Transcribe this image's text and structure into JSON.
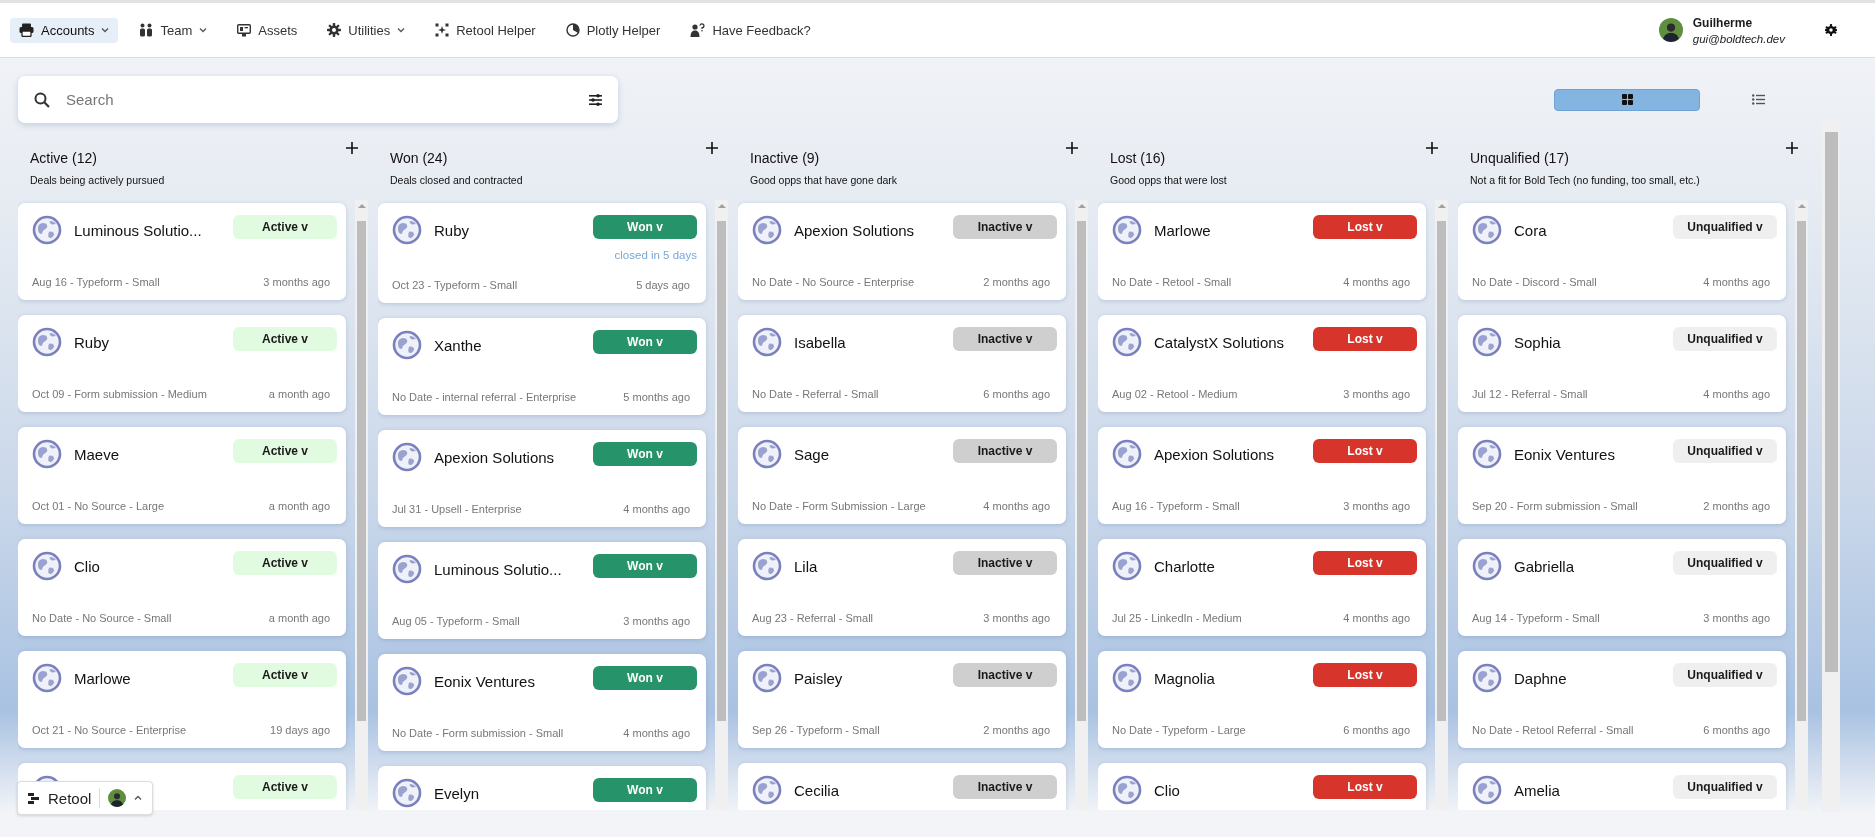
{
  "nav": [
    {
      "label": "Accounts",
      "dropdown": true,
      "selected": true
    },
    {
      "label": "Team",
      "dropdown": true,
      "selected": false
    },
    {
      "label": "Assets",
      "dropdown": false,
      "selected": false
    },
    {
      "label": "Utilities",
      "dropdown": true,
      "selected": false
    },
    {
      "label": "Retool Helper",
      "dropdown": false,
      "selected": false
    },
    {
      "label": "Plotly Helper",
      "dropdown": false,
      "selected": false
    },
    {
      "label": "Have Feedback?",
      "dropdown": false,
      "selected": false
    }
  ],
  "user": {
    "name": "Guilherme",
    "email": "gui@boldtech.dev"
  },
  "search": {
    "placeholder": "Search"
  },
  "view_toggle": [
    {
      "kind": "grid",
      "selected": true
    },
    {
      "kind": "list",
      "selected": false
    }
  ],
  "columns": [
    {
      "title": "Active (12)",
      "subtitle": "Deals being actively pursued",
      "cards": [
        {
          "name": "Luminous Solutio...",
          "status": "Active v",
          "kind": "active",
          "meta": "Aug 16 - Typeform - Small",
          "ago": "3 months ago"
        },
        {
          "name": "Ruby",
          "status": "Active v",
          "kind": "active",
          "meta": "Oct 09 - Form submission - Medium",
          "ago": "a month ago"
        },
        {
          "name": "Maeve",
          "status": "Active v",
          "kind": "active",
          "meta": "Oct 01 - No Source - Large",
          "ago": "a month ago"
        },
        {
          "name": "Clio",
          "status": "Active v",
          "kind": "active",
          "meta": "No Date - No Source - Small",
          "ago": "a month ago"
        },
        {
          "name": "Marlowe",
          "status": "Active v",
          "kind": "active",
          "meta": "Oct 21 - No Source - Enterprise",
          "ago": "19 days ago"
        },
        {
          "status": "Active v",
          "kind": "active"
        }
      ]
    },
    {
      "title": "Won (24)",
      "subtitle": "Deals closed and contracted",
      "cards": [
        {
          "name": "Ruby",
          "status": "Won v",
          "kind": "won",
          "note": "closed in 5 days",
          "meta": "Oct 23 - Typeform - Small",
          "ago": "5 days ago"
        },
        {
          "name": "Xanthe",
          "status": "Won v",
          "kind": "won",
          "meta": "No Date - internal referral - Enterprise",
          "ago": "5 months ago"
        },
        {
          "name": "Apexion Solutions",
          "status": "Won v",
          "kind": "won",
          "meta": "Jul 31 - Upsell - Enterprise",
          "ago": "4 months ago"
        },
        {
          "name": "Luminous Solutio...",
          "status": "Won v",
          "kind": "won",
          "meta": "Aug 05 - Typeform - Small",
          "ago": "3 months ago"
        },
        {
          "name": "Eonix Ventures",
          "status": "Won v",
          "kind": "won",
          "meta": "No Date - Form submission - Small",
          "ago": "4 months ago"
        },
        {
          "name": "Evelyn",
          "status": "Won v",
          "kind": "won"
        }
      ]
    },
    {
      "title": "Inactive (9)",
      "subtitle": "Good opps that have gone dark",
      "cards": [
        {
          "name": "Apexion Solutions",
          "status": "Inactive v",
          "kind": "inactive",
          "meta": "No Date - No Source - Enterprise",
          "ago": "2 months ago"
        },
        {
          "name": "Isabella",
          "status": "Inactive v",
          "kind": "inactive",
          "meta": "No Date - Referral - Small",
          "ago": "6 months ago"
        },
        {
          "name": "Sage",
          "status": "Inactive v",
          "kind": "inactive",
          "meta": "No Date - Form Submission - Large",
          "ago": "4 months ago"
        },
        {
          "name": "Lila",
          "status": "Inactive v",
          "kind": "inactive",
          "meta": "Aug 23 - Referral - Small",
          "ago": "3 months ago"
        },
        {
          "name": "Paisley",
          "status": "Inactive v",
          "kind": "inactive",
          "meta": "Sep 26 - Typeform - Small",
          "ago": "2 months ago"
        },
        {
          "name": "Cecilia",
          "status": "Inactive v",
          "kind": "inactive"
        }
      ]
    },
    {
      "title": "Lost (16)",
      "subtitle": "Good opps that were lost",
      "cards": [
        {
          "name": "Marlowe",
          "status": "Lost v",
          "kind": "lost",
          "meta": "No Date - Retool - Small",
          "ago": "4 months ago"
        },
        {
          "name": "CatalystX Solutions",
          "status": "Lost v",
          "kind": "lost",
          "meta": "Aug 02 - Retool - Medium",
          "ago": "3 months ago"
        },
        {
          "name": "Apexion Solutions",
          "status": "Lost v",
          "kind": "lost",
          "meta": "Aug 16 - Typeform - Small",
          "ago": "3 months ago"
        },
        {
          "name": "Charlotte",
          "status": "Lost v",
          "kind": "lost",
          "meta": "Jul 25 - LinkedIn - Medium",
          "ago": "4 months ago"
        },
        {
          "name": "Magnolia",
          "status": "Lost v",
          "kind": "lost",
          "meta": "No Date - Typeform - Large",
          "ago": "6 months ago"
        },
        {
          "name": "Clio",
          "status": "Lost v",
          "kind": "lost"
        }
      ]
    },
    {
      "title": "Unqualified (17)",
      "subtitle": "Not a fit for Bold Tech (no funding, too small, etc.)",
      "cards": [
        {
          "name": "Cora",
          "status": "Unqualified v",
          "kind": "unqualified",
          "meta": "No Date - Discord - Small",
          "ago": "4 months ago"
        },
        {
          "name": "Sophia",
          "status": "Unqualified v",
          "kind": "unqualified",
          "meta": "Jul 12 - Referral - Small",
          "ago": "4 months ago"
        },
        {
          "name": "Eonix Ventures",
          "status": "Unqualified v",
          "kind": "unqualified",
          "meta": "Sep 20 - Form submission - Small",
          "ago": "2 months ago"
        },
        {
          "name": "Gabriella",
          "status": "Unqualified v",
          "kind": "unqualified",
          "meta": "Aug 14 - Typeform - Small",
          "ago": "3 months ago"
        },
        {
          "name": "Daphne",
          "status": "Unqualified v",
          "kind": "unqualified",
          "meta": "No Date - Retool Referral - Small",
          "ago": "6 months ago"
        },
        {
          "name": "Amelia",
          "status": "Unqualified v",
          "kind": "unqualified"
        }
      ]
    }
  ],
  "badge": {
    "label": "Retool"
  }
}
